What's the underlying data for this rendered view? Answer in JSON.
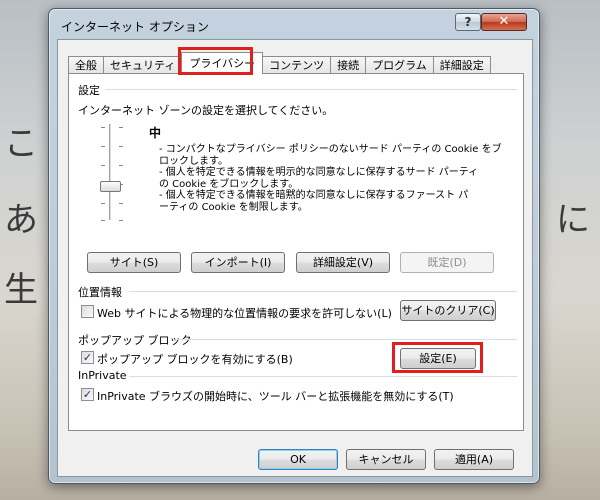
{
  "window": {
    "title": "インターネット オプション",
    "help_label": "?",
    "close_label": "✕"
  },
  "background_chars": [
    "こ",
    "あ",
    "に",
    "生"
  ],
  "tabs": [
    {
      "label": "全般"
    },
    {
      "label": "セキュリティ"
    },
    {
      "label": "プライバシー",
      "active": true
    },
    {
      "label": "コンテンツ"
    },
    {
      "label": "接続"
    },
    {
      "label": "プログラム"
    },
    {
      "label": "詳細設定"
    }
  ],
  "settings": {
    "group_title": "設定",
    "instruction": "インターネット ゾーンの設定を選択してください。",
    "level": "中",
    "description": [
      "- コンパクトなプライバシー ポリシーのないサード パーティの Cookie をブ",
      "ロックします。",
      "- 個人を特定できる情報を明示的な同意なしに保存するサード パーティ",
      "の Cookie をブロックします。",
      "- 個人を特定できる情報を暗黙的な同意なしに保存するファースト パ",
      "ーティの Cookie を制限します。"
    ],
    "buttons": {
      "sites": "サイト(S)",
      "import": "インポート(I)",
      "advanced": "詳細設定(V)",
      "default": "既定(D)"
    }
  },
  "location": {
    "group_title": "位置情報",
    "checkbox_label": "Web サイトによる物理的な位置情報の要求を許可しない(L)",
    "checked": false,
    "clear_button": "サイトのクリア(C)"
  },
  "popup": {
    "group_title": "ポップアップ ブロック",
    "checkbox_label": "ポップアップ ブロックを有効にする(B)",
    "checked": true,
    "settings_button": "設定(E)"
  },
  "inprivate": {
    "group_title": "InPrivate",
    "checkbox_label": "InPrivate ブラウズの開始時に、ツール バーと拡張機能を無効にする(T)",
    "checked": true
  },
  "footer": {
    "ok": "OK",
    "cancel": "キャンセル",
    "apply": "適用(A)"
  },
  "colors": {
    "highlight": "#e0201a",
    "close_button": "#c0462c"
  }
}
